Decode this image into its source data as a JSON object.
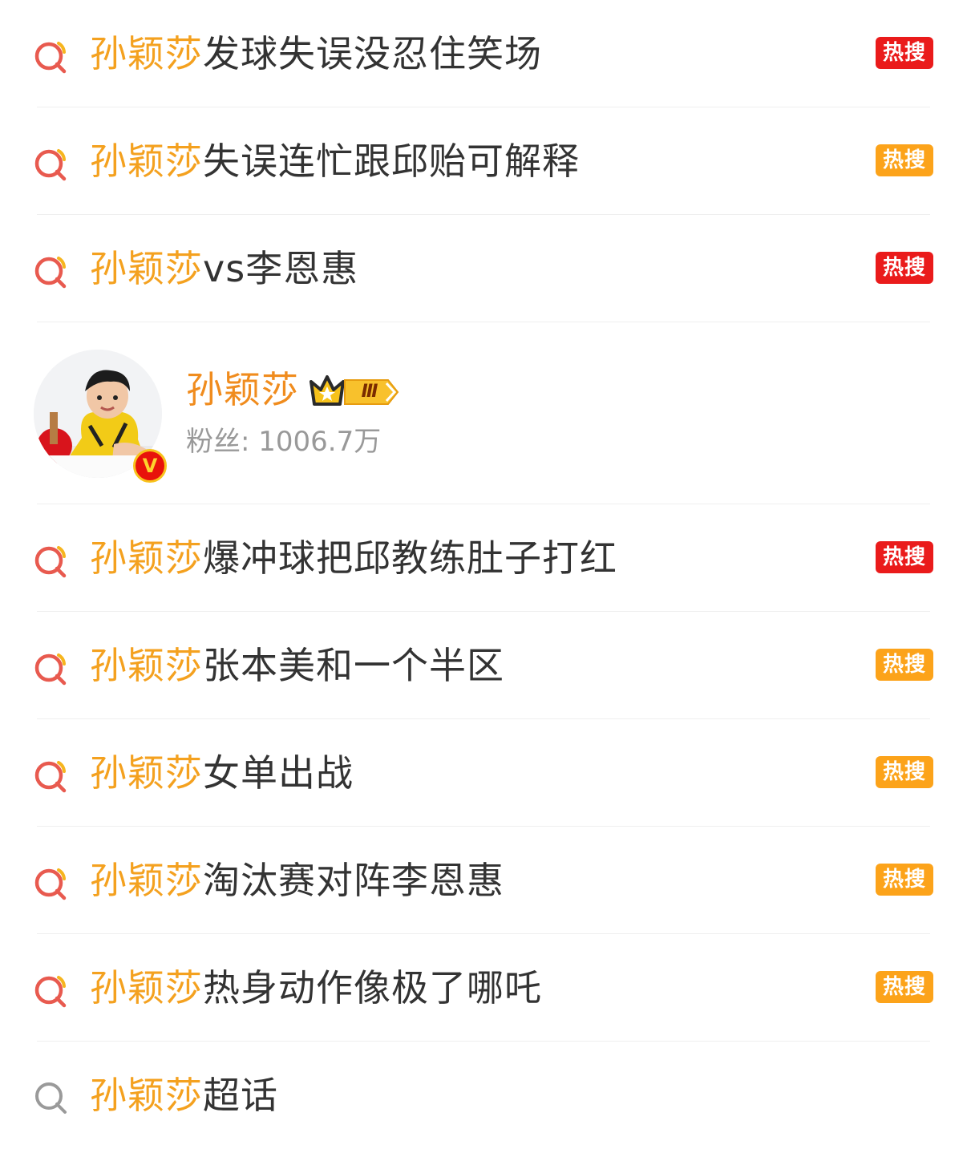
{
  "highlight": "孙颖莎",
  "colors": {
    "highlight": "#f4a11f",
    "badge_red": "#ea1b1b",
    "badge_orange": "#fca31a"
  },
  "items_top": [
    {
      "suffix": "发球失误没忍住笑场",
      "badge": "热搜",
      "badge_color": "red"
    },
    {
      "suffix": "失误连忙跟邱贻可解释",
      "badge": "热搜",
      "badge_color": "orange"
    },
    {
      "suffix": "vs李恩惠",
      "badge": "热搜",
      "badge_color": "red"
    }
  ],
  "user_card": {
    "name": "孙颖莎",
    "level_badge": "Ⅲ",
    "verified_mark": "V",
    "fans": "粉丝: 1006.7万"
  },
  "items_bottom": [
    {
      "suffix": "爆冲球把邱教练肚子打红",
      "badge": "热搜",
      "badge_color": "red"
    },
    {
      "suffix": "张本美和一个半区",
      "badge": "热搜",
      "badge_color": "orange"
    },
    {
      "suffix": "女单出战",
      "badge": "热搜",
      "badge_color": "orange"
    },
    {
      "suffix": "淘汰赛对阵李恩惠",
      "badge": "热搜",
      "badge_color": "orange"
    },
    {
      "suffix": "热身动作像极了哪吒",
      "badge": "热搜",
      "badge_color": "orange"
    }
  ],
  "topic_item": {
    "suffix": "超话"
  },
  "icons": {
    "hot_search": "hot-search-icon",
    "search": "search-icon",
    "crown": "crown-icon",
    "verified": "verified-icon"
  }
}
